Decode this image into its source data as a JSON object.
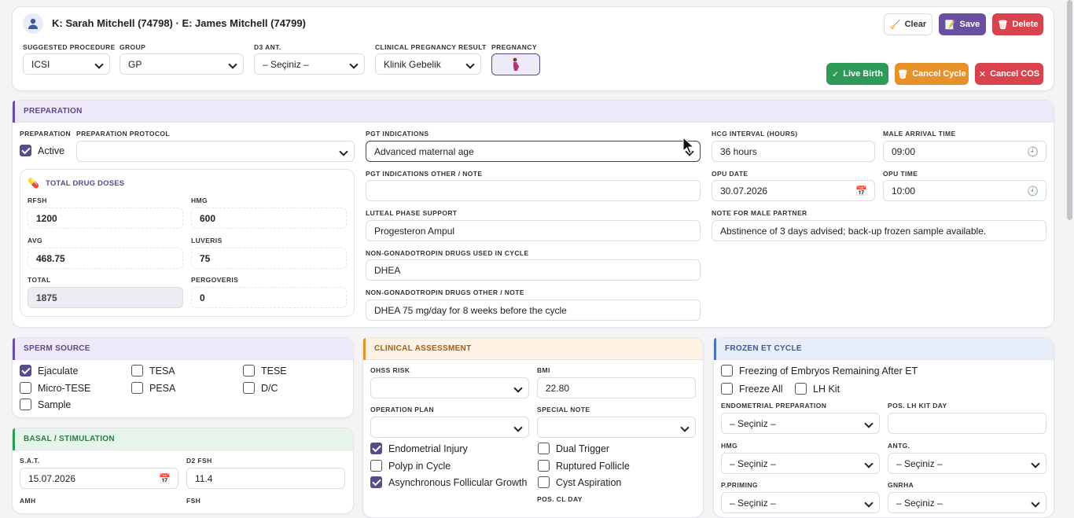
{
  "header": {
    "patient_title": "K: Sarah Mitchell (74798) · E: James Mitchell (74799)",
    "avatar_icon": "user-icon",
    "fields": {
      "suggested_procedure": {
        "label": "SUGGESTED PROCEDURE",
        "value": "ICSI"
      },
      "group": {
        "label": "GROUP",
        "value": "GP"
      },
      "d3_ant": {
        "label": "D3 ANT.",
        "value": "– Seçiniz –"
      },
      "clinical_pregnancy_result": {
        "label": "CLINICAL PREGNANCY RESULT",
        "value": "Klinik Gebelik"
      },
      "pregnancy": {
        "label": "PREGNANCY",
        "icon": "pregnant-woman-icon"
      }
    },
    "buttons": {
      "clear": "Clear",
      "save": "Save",
      "delete": "Delete",
      "live_birth": "Live Birth",
      "cancel_cycle": "Cancel Cycle",
      "cancel_cos": "Cancel COS"
    }
  },
  "preparation": {
    "title": "PREPARATION",
    "preparation_label": "PREPARATION",
    "active_label": "Active",
    "active_checked": true,
    "protocol_label": "PREPARATION PROTOCOL",
    "protocol_value": "",
    "drug_doses": {
      "title": "TOTAL DRUG DOSES",
      "icon": "pill-icon",
      "rfsh": {
        "label": "RFSH",
        "value": "1200"
      },
      "hmg": {
        "label": "HMG",
        "value": "600"
      },
      "avg": {
        "label": "AVG",
        "value": "468.75"
      },
      "luveris": {
        "label": "LUVERIS",
        "value": "75"
      },
      "total": {
        "label": "TOTAL",
        "value": "1875"
      },
      "pergoveris": {
        "label": "PERGOVERIS",
        "value": "0"
      }
    },
    "pgt_indications": {
      "label": "PGT INDICATIONS",
      "value": "Advanced maternal age"
    },
    "pgt_other": {
      "label": "PGT INDICATIONS OTHER / NOTE",
      "value": ""
    },
    "luteal_phase": {
      "label": "LUTEAL PHASE SUPPORT",
      "value": "Progesteron Ampul"
    },
    "non_gonado": {
      "label": "NON-GONADOTROPIN DRUGS USED IN CYCLE",
      "value": "DHEA"
    },
    "non_gonado_other": {
      "label": "NON-GONADOTROPIN DRUGS OTHER / NOTE",
      "value": "DHEA 75 mg/day for 8 weeks before the cycle"
    },
    "hcg_interval": {
      "label": "HCG INTERVAL (HOURS)",
      "value": "36 hours"
    },
    "male_arrival": {
      "label": "MALE ARRIVAL TIME",
      "value": "09:00"
    },
    "opu_date": {
      "label": "OPU DATE",
      "value": "30.07.2026"
    },
    "opu_time": {
      "label": "OPU TIME",
      "value": "10:00"
    },
    "note_male": {
      "label": "NOTE FOR MALE PARTNER",
      "value": "Abstinence of 3 days advised; back-up frozen sample available."
    }
  },
  "sperm_source": {
    "title": "SPERM SOURCE",
    "options": [
      {
        "label": "Ejaculate",
        "checked": true
      },
      {
        "label": "TESA",
        "checked": false
      },
      {
        "label": "TESE",
        "checked": false
      },
      {
        "label": "Micro-TESE",
        "checked": false
      },
      {
        "label": "PESA",
        "checked": false
      },
      {
        "label": "D/C",
        "checked": false
      },
      {
        "label": "Sample",
        "checked": false
      }
    ]
  },
  "basal": {
    "title": "BASAL / STIMULATION",
    "sat": {
      "label": "S.A.T.",
      "value": "15.07.2026"
    },
    "d2_fsh": {
      "label": "D2 FSH",
      "value": "11.4"
    },
    "amh": {
      "label": "AMH"
    },
    "fsh": {
      "label": "FSH"
    }
  },
  "clinical": {
    "title": "CLINICAL ASSESSMENT",
    "ohss_risk": {
      "label": "OHSS RISK",
      "value": ""
    },
    "bmi": {
      "label": "BMI",
      "value": "22.80"
    },
    "operation_plan": {
      "label": "OPERATION PLAN",
      "value": ""
    },
    "special_note": {
      "label": "SPECIAL NOTE",
      "value": ""
    },
    "checks": [
      {
        "label": "Endometrial Injury",
        "checked": true
      },
      {
        "label": "Dual Trigger",
        "checked": false
      },
      {
        "label": "Polyp in Cycle",
        "checked": false
      },
      {
        "label": "Ruptured Follicle",
        "checked": false
      },
      {
        "label": "Asynchronous Follicular Growth",
        "checked": true
      },
      {
        "label": "Cyst Aspiration",
        "checked": false
      }
    ],
    "pos_cl_day": {
      "label": "POS. CL DAY"
    }
  },
  "frozen": {
    "title": "FROZEN ET CYCLE",
    "freezing_remaining": {
      "label": "Freezing of Embryos Remaining After ET",
      "checked": false
    },
    "freeze_all": {
      "label": "Freeze All",
      "checked": false
    },
    "lh_kit": {
      "label": "LH Kit",
      "checked": false
    },
    "endometrial_prep": {
      "label": "ENDOMETRIAL PREPARATION",
      "value": "– Seçiniz –"
    },
    "pos_lh_kit_day": {
      "label": "POS. LH KIT DAY",
      "value": ""
    },
    "hmg": {
      "label": "HMG",
      "value": "– Seçiniz –"
    },
    "antg": {
      "label": "ANTG.",
      "value": "– Seçiniz –"
    },
    "p_priming": {
      "label": "P.PRIMING",
      "value": "– Seçiniz –"
    },
    "gnrha": {
      "label": "GNRHA",
      "value": "– Seçiniz –"
    }
  },
  "colors": {
    "save": "#6a4fa0",
    "delete": "#d9434e",
    "live_birth": "#2e9a58",
    "cancel_cycle": "#e6912a",
    "cancel_cos": "#d9434e",
    "prep_header": "#eee9f8",
    "prep_accent": "#6a4fa0",
    "clinical_header": "#fdf1e3",
    "clinical_accent": "#e6912a",
    "basal_header": "#e6f4ec",
    "basal_accent": "#2e9a58",
    "frozen_header": "#e7eef9",
    "frozen_accent": "#4a73c2"
  }
}
